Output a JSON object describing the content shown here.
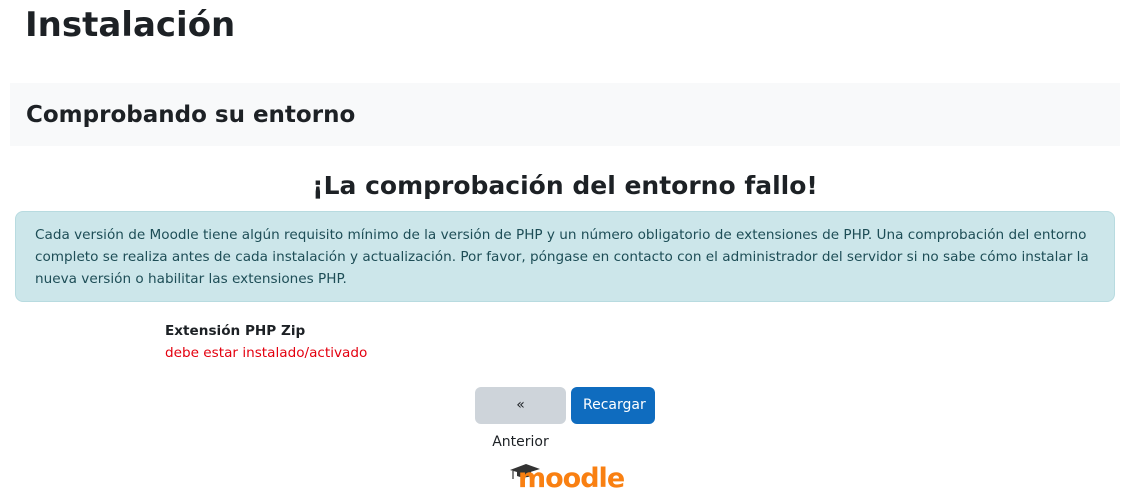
{
  "page": {
    "title": "Instalación",
    "section_title": "Comprobando su entorno",
    "fail_heading": "¡La comprobación del entorno fallo!"
  },
  "alert": {
    "text": "Cada versión de Moodle tiene algún requisito mínimo de la versión de PHP y un número obligatorio de extensiones de PHP. Una comprobación del entorno completo se realiza antes de cada instalación y actualización. Por favor, póngase en contacto con el administrador del servidor si no sabe cómo instalar la nueva versión o habilitar las extensiones PHP."
  },
  "requirement": {
    "name": "Extensión PHP Zip",
    "status": "debe estar instalado/activado"
  },
  "buttons": {
    "previous": "« Anterior",
    "reload": "Recargar"
  },
  "logo": {
    "text": "moodle",
    "icon": "mortarboard-icon",
    "color": "#f98012"
  }
}
